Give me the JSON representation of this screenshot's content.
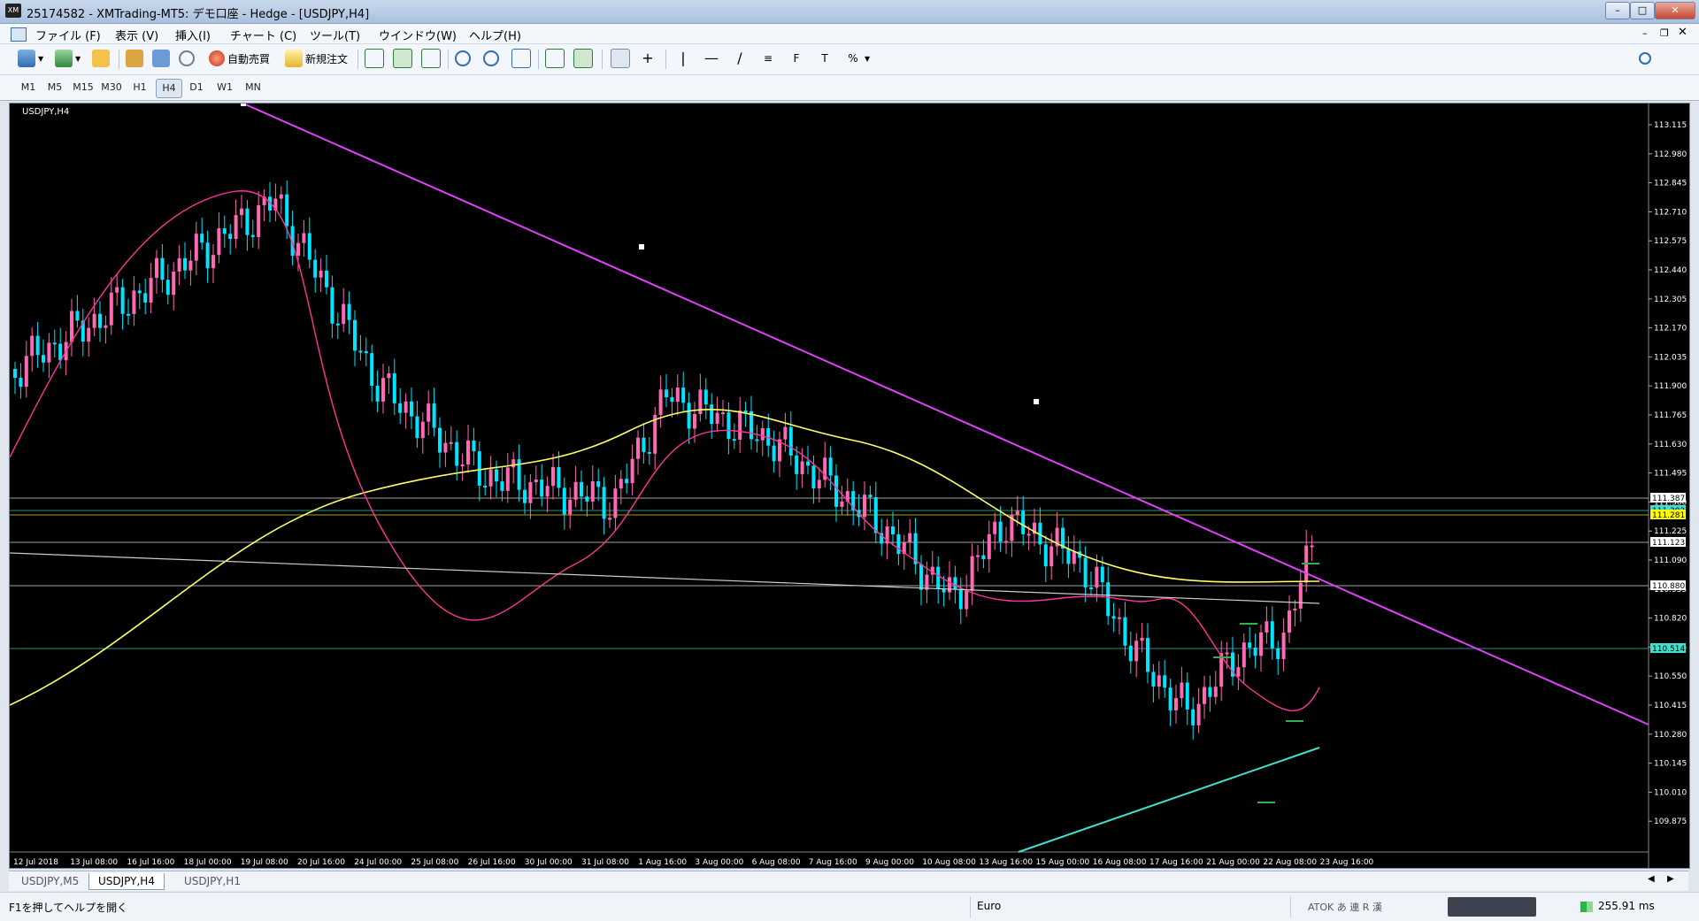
{
  "window": {
    "title": "25174582 - XMTrading-MT5: デモ口座 - Hedge - [USDJPY,H4]",
    "app_icon": "XM"
  },
  "menu": [
    "ファイル (F)",
    "表示 (V)",
    "挿入(I)",
    "チャート (C)",
    "ツール(T)",
    "ウインドウ(W)",
    "ヘルプ(H)"
  ],
  "toolbar": {
    "auto_trading": "自動売買",
    "new_order": "新規注文"
  },
  "timeframes": [
    "M1",
    "M5",
    "M15",
    "M30",
    "H1",
    "H4",
    "D1",
    "W1",
    "MN"
  ],
  "active_timeframe": "H4",
  "chart": {
    "symbol_label": "USDJPY,H4",
    "price_axis": [
      "113.115",
      "112.980",
      "112.845",
      "112.710",
      "112.575",
      "112.440",
      "112.305",
      "112.170",
      "112.035",
      "111.900",
      "111.765",
      "111.630",
      "111.495",
      "111.360",
      "111.225",
      "111.090",
      "110.955",
      "110.820",
      "110.685",
      "110.550",
      "110.415",
      "110.280",
      "110.145",
      "110.010",
      "109.875"
    ],
    "price_tags": [
      {
        "text": "111.387",
        "color": "#ffffff"
      },
      {
        "text": "111.303",
        "color": "#40e0d0"
      },
      {
        "text": "111.281",
        "color": "#ffff00"
      },
      {
        "text": "111.123",
        "color": "#ffffff"
      },
      {
        "text": "110.880",
        "color": "#ffffff"
      },
      {
        "text": "110.514",
        "color": "#40e0d0"
      }
    ],
    "time_axis": [
      "12 Jul 2018",
      "13 Jul 08:00",
      "16 Jul 16:00",
      "18 Jul 00:00",
      "19 Jul 08:00",
      "20 Jul 16:00",
      "24 Jul 00:00",
      "25 Jul 08:00",
      "26 Jul 16:00",
      "30 Jul 00:00",
      "31 Jul 08:00",
      "1 Aug 16:00",
      "3 Aug 00:00",
      "6 Aug 08:00",
      "7 Aug 16:00",
      "9 Aug 00:00",
      "10 Aug 08:00",
      "13 Aug 16:00",
      "15 Aug 00:00",
      "16 Aug 08:00",
      "17 Aug 16:00",
      "21 Aug 00:00",
      "22 Aug 08:00",
      "23 Aug 16:00"
    ],
    "colors": {
      "bull": "#ff69b4",
      "bear": "#00e5ff",
      "ma_short": "#ff3399",
      "ma_long": "#ffff66",
      "trendline": "#e040fb",
      "support": "#40e0d0"
    }
  },
  "chart_tabs": [
    "USDJPY,M5",
    "USDJPY,H4",
    "USDJPY,H1"
  ],
  "active_chart_tab": "USDJPY,H4",
  "status": {
    "help": "F1を押してヘルプを開く",
    "profile": "Euro",
    "ime": "ATOK あ 連 R 漢",
    "ping": "255.91 ms"
  }
}
